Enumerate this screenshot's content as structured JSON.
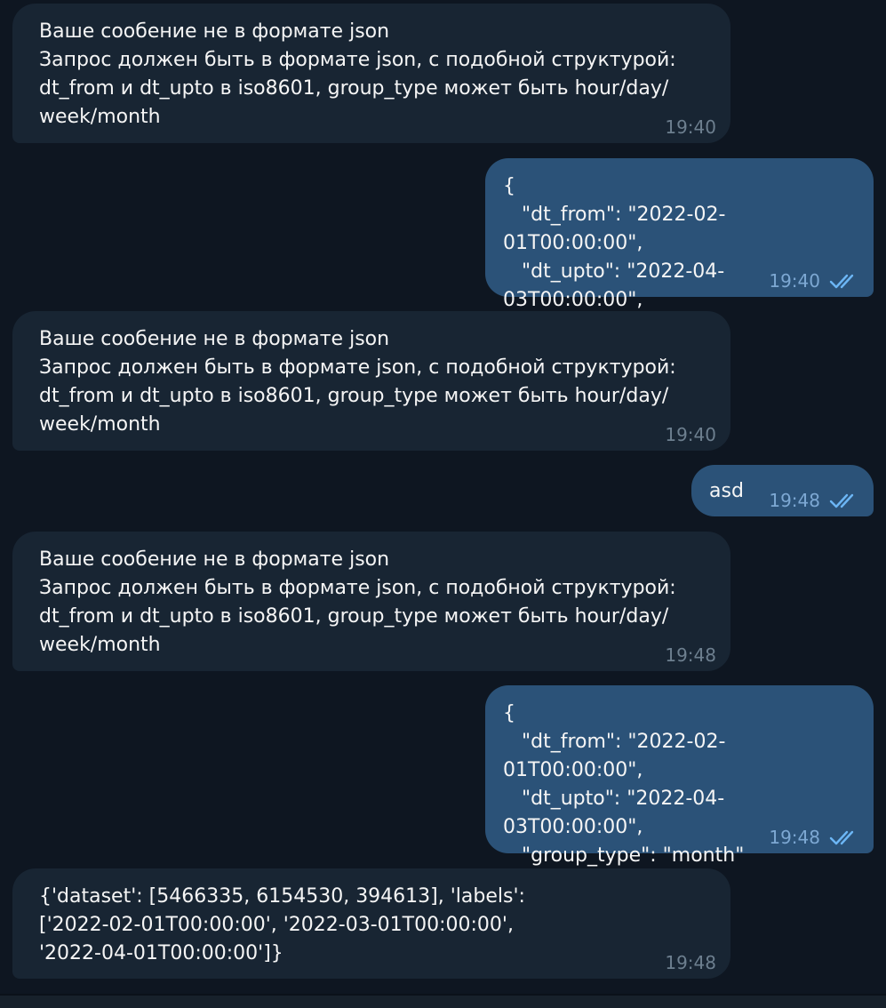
{
  "messages": [
    {
      "direction": "in",
      "text": "Ваше сообение не в формате json\nЗапрос должен быть в формате json, с подобной структурой:\ndt_from и dt_upto в iso8601, group_type может быть hour/day/\nweek/month",
      "time": "19:40"
    },
    {
      "direction": "out",
      "text": "{\n   \"dt_from\": \"2022-02-01T00:00:00\",\n   \"dt_upto\": \"2022-04-03T00:00:00\",\n}",
      "time": "19:40",
      "status": "read-checkmarks-icon"
    },
    {
      "direction": "in",
      "text": "Ваше сообение не в формате json\nЗапрос должен быть в формате json, с подобной структурой:\ndt_from и dt_upto в iso8601, group_type может быть hour/day/\nweek/month",
      "time": "19:40"
    },
    {
      "direction": "out",
      "text": "asd",
      "time": "19:48",
      "status": "read-checkmarks-icon"
    },
    {
      "direction": "in",
      "text": "Ваше сообение не в формате json\nЗапрос должен быть в формате json, с подобной структурой:\ndt_from и dt_upto в iso8601, group_type может быть hour/day/\nweek/month",
      "time": "19:48"
    },
    {
      "direction": "out",
      "text": "{\n   \"dt_from\": \"2022-02-01T00:00:00\",\n   \"dt_upto\": \"2022-04-03T00:00:00\",\n   \"group_type\": \"month\"\n}",
      "time": "19:48",
      "status": "read-checkmarks-icon"
    },
    {
      "direction": "in",
      "text": "{'dataset': [5466335, 6154530, 394613], 'labels':\n['2022-02-01T00:00:00', '2022-03-01T00:00:00',\n'2022-04-01T00:00:00']}",
      "time": "19:48"
    }
  ],
  "colors": {
    "background": "#0e1621",
    "incoming_bubble": "#182533",
    "outgoing_bubble": "#2b5278",
    "incoming_time": "#6d7f8f",
    "outgoing_time": "#7da8d3",
    "read_check": "#6cb6f5"
  }
}
